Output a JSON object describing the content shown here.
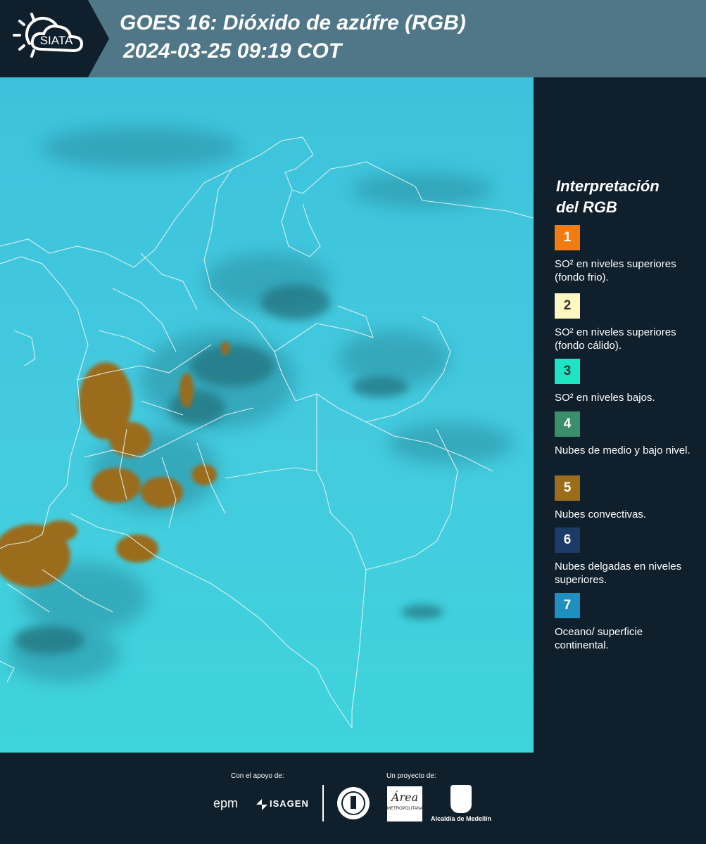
{
  "header": {
    "logo_text": "SIATA",
    "title_line1": "GOES 16: Dióxido de azúfre (RGB)",
    "title_line2": "2024-03-25 09:19 COT"
  },
  "legend": {
    "title_line1": "Interpretación",
    "title_line2": "del RGB",
    "items": [
      {
        "num": "1",
        "color": "#f07d14",
        "text": "SO² en niveles superiores (fondo frio)."
      },
      {
        "num": "2",
        "color": "#fdf7c2",
        "text": "SO² en niveles superiores (fondo cálido)."
      },
      {
        "num": "3",
        "color": "#1de5c4",
        "text": "SO² en niveles bajos."
      },
      {
        "num": "4",
        "color": "#3b8e6a",
        "text": "Nubes de medio y bajo nivel."
      },
      {
        "num": "5",
        "color": "#9a6c1c",
        "text": "Nubes convectivas."
      },
      {
        "num": "6",
        "color": "#1c3b66",
        "text": "Nubes delgadas en niveles superiores."
      },
      {
        "num": "7",
        "color": "#1f8fbf",
        "text": "Oceano/ superficie continental."
      }
    ]
  },
  "footer": {
    "support_label": "Con el apoyo de:",
    "project_label": "Un proyecto de:",
    "epm_logo": "epm",
    "isagen_logo": "ISAGEN",
    "metro_logo": "Área",
    "metro_sub": "METROPOLITANA",
    "alcaldia_label": "Alcaldía de Medellín"
  },
  "colors": {
    "header_bg": "#4f7787",
    "logo_bg": "#0f1f2b",
    "map_base": "#3fc7dd",
    "convective": "#9a6c1c",
    "dark_band": "#1f6f78"
  }
}
